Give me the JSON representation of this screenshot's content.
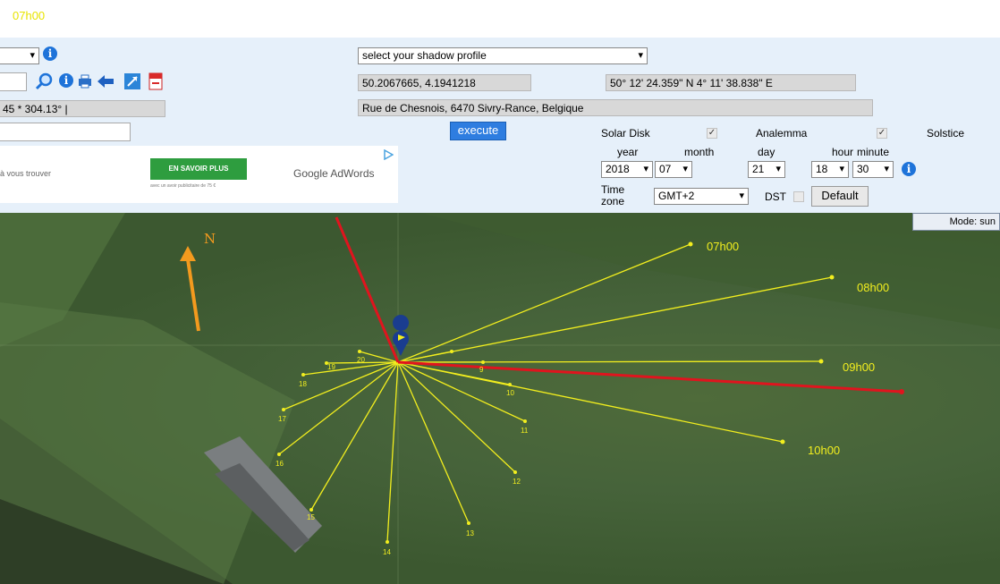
{
  "header": {
    "time_label": "07h00"
  },
  "left_panel": {
    "coords_text": "45 * 304.13° |",
    "search_value": ""
  },
  "shadow_profile": {
    "selected": "select your shadow profile"
  },
  "location": {
    "decimal": "50.2067665, 4.1941218",
    "dms": "50° 12' 24.359\" N    4° 11' 38.838\" E",
    "address": "Rue de Chesnois, 6470 Sivry-Rance, Belgique"
  },
  "execute_label": "execute",
  "options": {
    "solar_disk_label": "Solar Disk",
    "analemma_label": "Analemma",
    "solstice_label": "Solstice",
    "solar_disk_checked": true,
    "analemma_checked": true
  },
  "date_time": {
    "year_label": "year",
    "month_label": "month",
    "day_label": "day",
    "hour_label": "hour",
    "minute_label": "minute",
    "year": "2018",
    "month": "07",
    "day": "21",
    "hour": "18",
    "minute": "30"
  },
  "timezone": {
    "label_line1": "Time",
    "label_line2": "zone",
    "value": "GMT+2",
    "dst_label": "DST",
    "default_label": "Default"
  },
  "ad": {
    "left_text": "à vous trouver",
    "cta_label": "EN SAVOIR PLUS",
    "cta_sub": "avec un avoir publicitaire de 75 €",
    "brand": "Google AdWords"
  },
  "map": {
    "mode_label": "Mode: sun",
    "north_label": "N",
    "hour_labels_large": [
      "07h00",
      "08h00",
      "09h00",
      "10h00"
    ],
    "hour_labels_small": [
      "9",
      "10",
      "11",
      "12",
      "13",
      "14",
      "15",
      "16",
      "17",
      "18",
      "19",
      "20"
    ]
  },
  "colors": {
    "shadow_lines": "#f2ee1e",
    "sun_line": "#e0141e",
    "north_arrow": "#f39a1e",
    "accent": "#2e7de0"
  }
}
